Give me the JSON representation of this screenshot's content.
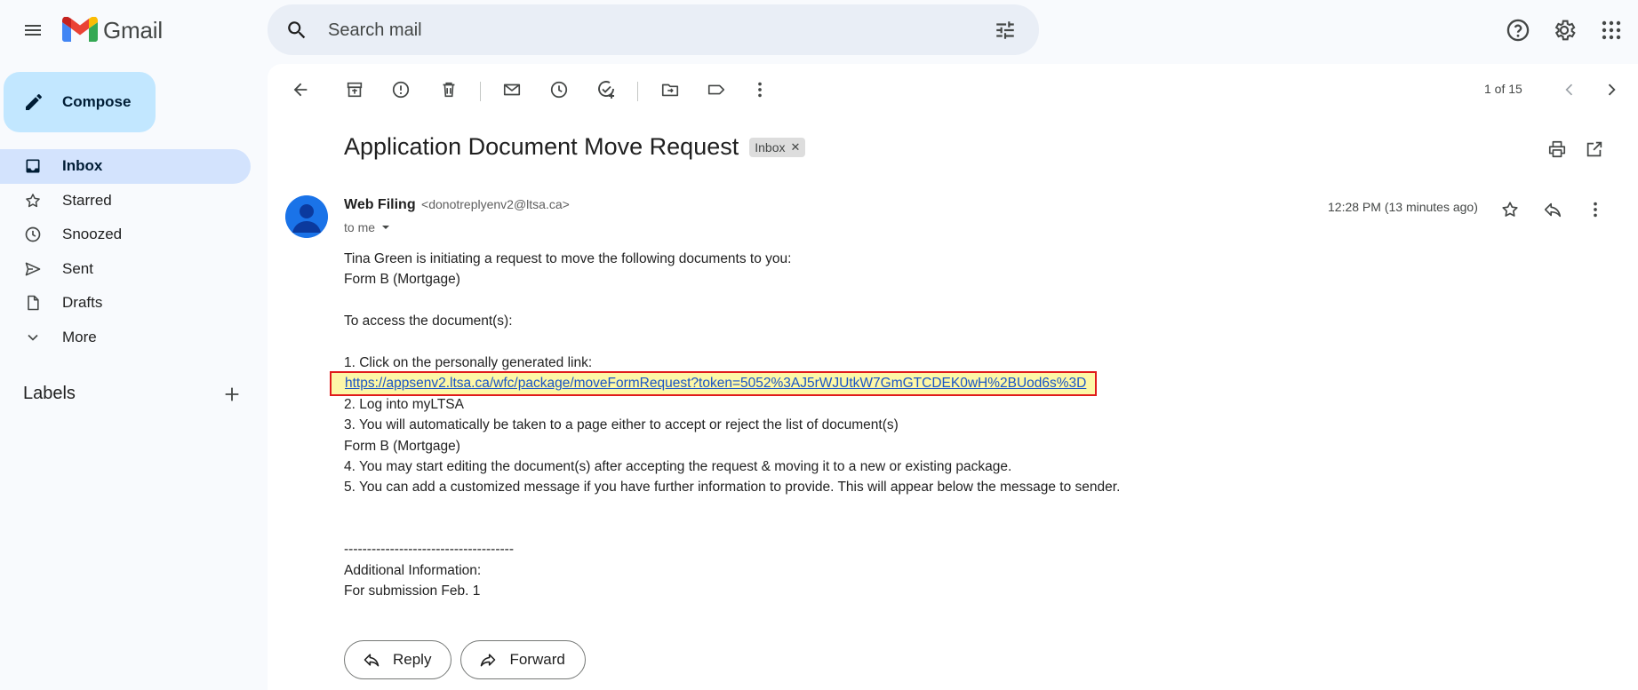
{
  "app": {
    "name": "Gmail"
  },
  "search": {
    "placeholder": "Search mail"
  },
  "compose": {
    "label": "Compose"
  },
  "sidebar": {
    "items": [
      {
        "label": "Inbox",
        "icon": "inbox-icon",
        "active": true
      },
      {
        "label": "Starred",
        "icon": "star-icon"
      },
      {
        "label": "Snoozed",
        "icon": "clock-icon"
      },
      {
        "label": "Sent",
        "icon": "send-icon"
      },
      {
        "label": "Drafts",
        "icon": "draft-icon"
      },
      {
        "label": "More",
        "icon": "chevron-down-icon"
      }
    ],
    "labels_title": "Labels"
  },
  "toolbar": {
    "pager": "1 of 15"
  },
  "message": {
    "subject": "Application Document Move Request",
    "chip": "Inbox",
    "sender_name": "Web Filing",
    "sender_email": "<donotreplyenv2@ltsa.ca>",
    "to": "to me",
    "time": "12:28 PM (13 minutes ago)",
    "body": {
      "l1": "Tina Green is initiating a request to move the following documents to you:",
      "l2": "Form B (Mortgage)",
      "l3": "To access the document(s):",
      "l4": "1.  Click on the personally generated link:",
      "link": "https://appsenv2.ltsa.ca/wfc/package/moveFormRequest?token=5052%3AJ5rWJUtkW7GmGTCDEK0wH%2BUod6s%3D",
      "l5": "2.  Log into myLTSA",
      "l6": "3.  You will automatically be taken to a page either to accept or reject the list of document(s)",
      "l7": "Form B (Mortgage)",
      "l8": "4. You may start editing the document(s) after accepting the request & moving it to a new or existing package.",
      "l9": "5. You can add a customized message if you have further information to provide. This will appear below the message to sender.",
      "divider": "-------------------------------------",
      "l10": "Additional Information:",
      "l11": "For submission Feb. 1"
    }
  },
  "actions": {
    "reply": "Reply",
    "forward": "Forward"
  },
  "colors": {
    "compose_bg": "#c2e7ff",
    "active_nav": "#d3e3fd",
    "highlight_border": "#e01b1b",
    "highlight_bg": "#fdf7a7",
    "link": "#1a55c5"
  }
}
